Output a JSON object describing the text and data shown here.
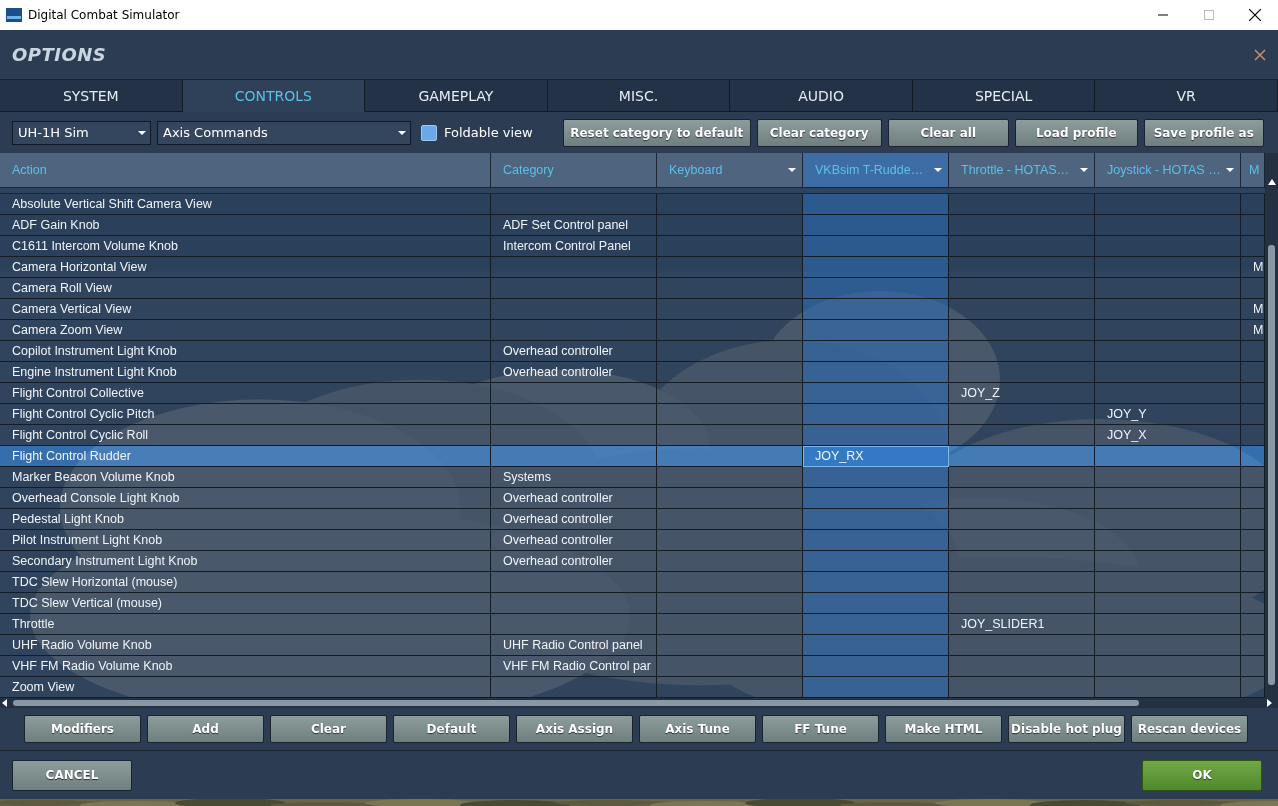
{
  "window": {
    "title": "Digital Combat Simulator"
  },
  "dialog": {
    "title": "OPTIONS"
  },
  "tabs": [
    {
      "label": "SYSTEM",
      "selected": false
    },
    {
      "label": "CONTROLS",
      "selected": true
    },
    {
      "label": "GAMEPLAY",
      "selected": false
    },
    {
      "label": "MISC.",
      "selected": false
    },
    {
      "label": "AUDIO",
      "selected": false
    },
    {
      "label": "SPECIAL",
      "selected": false
    },
    {
      "label": "VR",
      "selected": false
    }
  ],
  "toolbar": {
    "aircraft": "UH-1H Sim",
    "category": "Axis Commands",
    "foldable_view": {
      "label": "Foldable view",
      "checked": false
    },
    "buttons": [
      "Reset category to default",
      "Clear category",
      "Clear all",
      "Load profile",
      "Save profile as"
    ]
  },
  "table": {
    "columns": [
      {
        "label": "Action",
        "selected": false,
        "dropdown": false
      },
      {
        "label": "Category",
        "selected": false,
        "dropdown": false
      },
      {
        "label": "Keyboard",
        "selected": false,
        "dropdown": true
      },
      {
        "label": "VKBsim T-Rudde…",
        "selected": true,
        "dropdown": true
      },
      {
        "label": "Throttle - HOTAS…",
        "selected": false,
        "dropdown": true
      },
      {
        "label": "Joystick - HOTAS …",
        "selected": false,
        "dropdown": true
      },
      {
        "label": "M",
        "selected": false,
        "dropdown": false
      }
    ],
    "rows": [
      {
        "cells": [
          "Absolute Vertical Shift Camera View",
          null,
          null,
          null,
          null,
          null,
          null
        ],
        "selected": false
      },
      {
        "cells": [
          "ADF Gain Knob",
          "ADF Set Control panel",
          null,
          null,
          null,
          null,
          null
        ],
        "selected": false
      },
      {
        "cells": [
          "C1611 Intercom Volume Knob",
          "Intercom Control Panel",
          null,
          null,
          null,
          null,
          null
        ],
        "selected": false
      },
      {
        "cells": [
          "Camera Horizontal View",
          null,
          null,
          null,
          null,
          null,
          "M"
        ],
        "selected": false
      },
      {
        "cells": [
          "Camera Roll View",
          null,
          null,
          null,
          null,
          null,
          null
        ],
        "selected": false
      },
      {
        "cells": [
          "Camera Vertical View",
          null,
          null,
          null,
          null,
          null,
          "M"
        ],
        "selected": false
      },
      {
        "cells": [
          "Camera Zoom View",
          null,
          null,
          null,
          null,
          null,
          "M"
        ],
        "selected": false
      },
      {
        "cells": [
          "Copilot Instrument Light Knob",
          "Overhead controller",
          null,
          null,
          null,
          null,
          null
        ],
        "selected": false
      },
      {
        "cells": [
          "Engine Instrument Light Knob",
          "Overhead controller",
          null,
          null,
          null,
          null,
          null
        ],
        "selected": false
      },
      {
        "cells": [
          "Flight Control Collective",
          null,
          null,
          null,
          "JOY_Z",
          null,
          null
        ],
        "selected": false
      },
      {
        "cells": [
          "Flight Control Cyclic Pitch",
          null,
          null,
          null,
          null,
          "JOY_Y",
          null
        ],
        "selected": false
      },
      {
        "cells": [
          "Flight Control Cyclic Roll",
          null,
          null,
          null,
          null,
          "JOY_X",
          null
        ],
        "selected": false
      },
      {
        "cells": [
          "Flight Control Rudder",
          null,
          null,
          "JOY_RX",
          null,
          null,
          null
        ],
        "selected": true
      },
      {
        "cells": [
          "Marker Beacon Volume Knob",
          "Systems",
          null,
          null,
          null,
          null,
          null
        ],
        "selected": false
      },
      {
        "cells": [
          "Overhead Console Light Knob",
          "Overhead controller",
          null,
          null,
          null,
          null,
          null
        ],
        "selected": false
      },
      {
        "cells": [
          "Pedestal Light Knob",
          "Overhead controller",
          null,
          null,
          null,
          null,
          null
        ],
        "selected": false
      },
      {
        "cells": [
          "Pilot Instrument Light Knob",
          "Overhead controller",
          null,
          null,
          null,
          null,
          null
        ],
        "selected": false
      },
      {
        "cells": [
          "Secondary Instrument Light Knob",
          "Overhead controller",
          null,
          null,
          null,
          null,
          null
        ],
        "selected": false
      },
      {
        "cells": [
          "TDC Slew Horizontal (mouse)",
          null,
          null,
          null,
          null,
          null,
          null
        ],
        "selected": false
      },
      {
        "cells": [
          "TDC Slew Vertical (mouse)",
          null,
          null,
          null,
          null,
          null,
          null
        ],
        "selected": false
      },
      {
        "cells": [
          "Throttle",
          null,
          null,
          null,
          "JOY_SLIDER1",
          null,
          null
        ],
        "selected": false
      },
      {
        "cells": [
          "UHF Radio Volume Knob",
          "UHF Radio Control panel",
          null,
          null,
          null,
          null,
          null
        ],
        "selected": false
      },
      {
        "cells": [
          "VHF FM Radio Volume Knob",
          "VHF FM Radio Control par",
          null,
          null,
          null,
          null,
          null
        ],
        "selected": false
      },
      {
        "cells": [
          "Zoom View",
          null,
          null,
          null,
          null,
          null,
          null
        ],
        "selected": false
      }
    ]
  },
  "action_buttons": [
    "Modifiers",
    "Add",
    "Clear",
    "Default",
    "Axis Assign",
    "Axis Tune",
    "FF Tune",
    "Make HTML",
    "Disable hot plug",
    "Rescan devices"
  ],
  "footer": {
    "cancel": "CANCEL",
    "ok": "OK"
  }
}
